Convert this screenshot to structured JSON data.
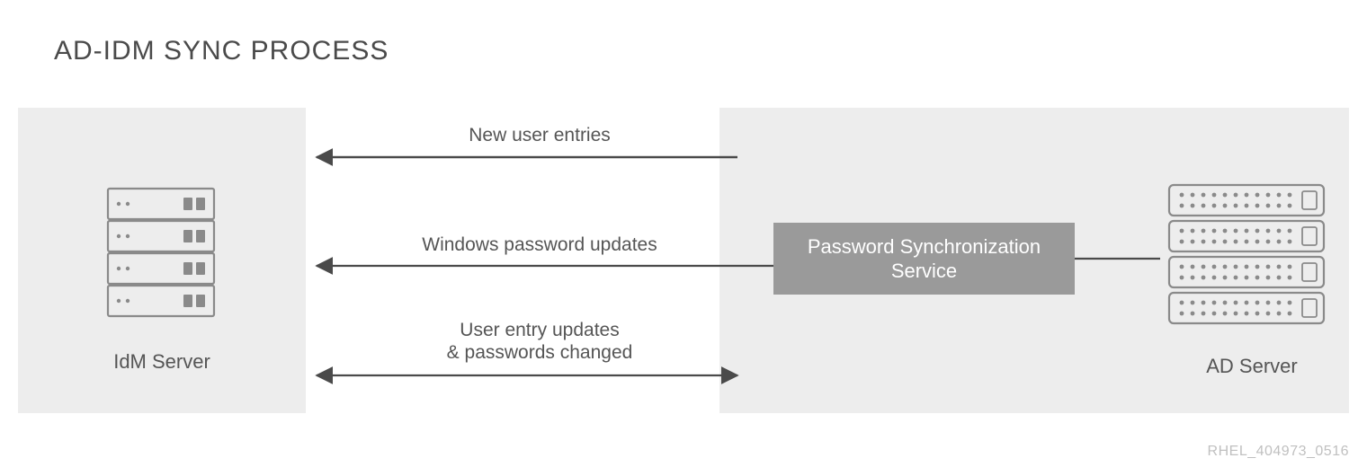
{
  "title": "AD-IDM SYNC PROCESS",
  "left_server_label": "IdM Server",
  "right_server_label": "AD Server",
  "pss_box": "Password Synchronization Service",
  "arrows": {
    "a1": "New user entries",
    "a2": "Windows password updates",
    "a3": "User entry updates\n& passwords changed"
  },
  "footer": "RHEL_404973_0516",
  "colors": {
    "panel": "#ededed",
    "pss": "#9a9a9a",
    "text": "#4a4a4a",
    "arrow": "#4a4a4a"
  }
}
